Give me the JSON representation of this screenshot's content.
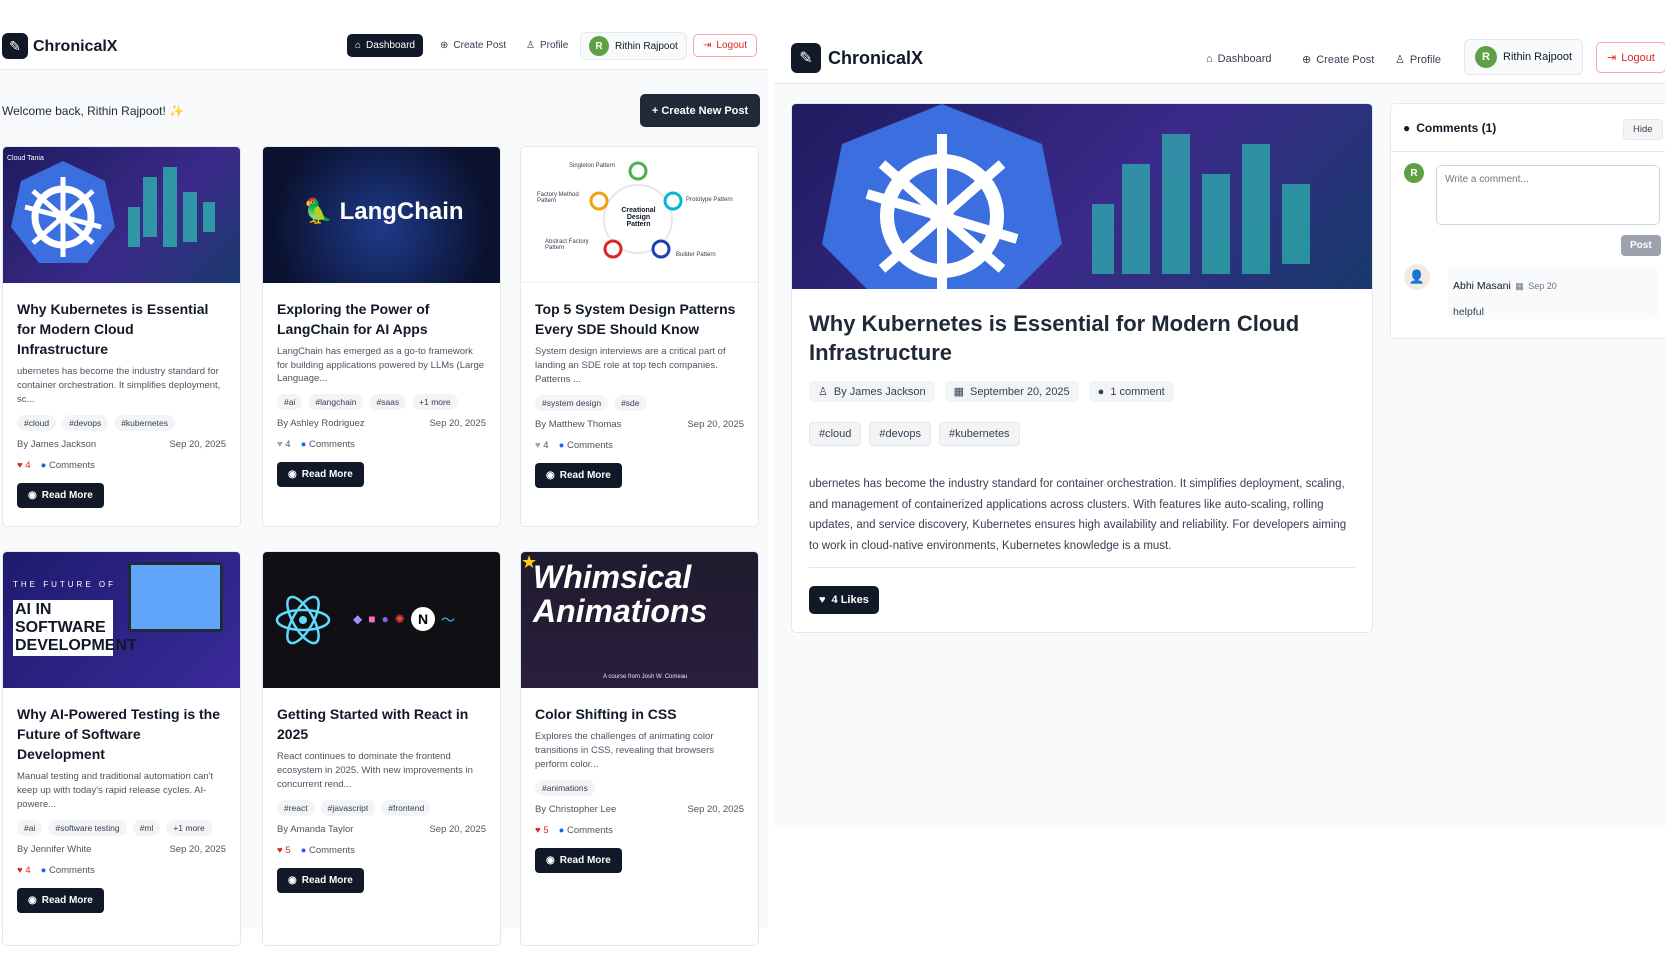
{
  "nav": {
    "brand": "ChronicalX",
    "dashboard": "Dashboard",
    "create_post": "Create Post",
    "profile": "Profile",
    "user_name": "Rithin Rajpoot",
    "user_initial": "R",
    "logout": "Logout"
  },
  "dashboard": {
    "welcome": "Welcome back, Rithin Rajpoot! ✨",
    "create_new_post": "Create New Post",
    "read_more": "Read More",
    "comments_label": "Comments",
    "posts": [
      {
        "title": "Why Kubernetes is Essential for Modern Cloud Infrastructure",
        "excerpt": "ubernetes has become the industry standard for container orchestration. It simplifies deployment, sc...",
        "tags": [
          "#cloud",
          "#devops",
          "#kubernetes"
        ],
        "author": "By James Jackson",
        "date": "Sep 20, 2025",
        "likes": "4",
        "liked": true,
        "image_text": "Cloud Tania"
      },
      {
        "title": "Exploring the Power of LangChain for AI Apps",
        "excerpt": "LangChain has emerged as a go-to framework for building applications powered by LLMs (Large Language...",
        "tags": [
          "#ai",
          "#langchain",
          "#saas",
          "+1 more"
        ],
        "author": "By Ashley Rodriguez",
        "date": "Sep 20, 2025",
        "likes": "4",
        "liked": false,
        "image_text": "LangChain"
      },
      {
        "title": "Top 5 System Design Patterns Every SDE Should Know",
        "excerpt": "System design interviews are a critical part of landing an SDE role at top tech companies. Patterns ...",
        "tags": [
          "#system design",
          "#sde"
        ],
        "author": "By Matthew Thomas",
        "date": "Sep 20, 2025",
        "likes": "4",
        "liked": false,
        "image_text": "Creational Design Pattern",
        "diagram": [
          "Singleton Pattern",
          "Factory Method Pattern",
          "Prototype Pattern",
          "Abstract Factory Pattern",
          "Builder Pattern"
        ]
      },
      {
        "title": "Why AI-Powered Testing is the Future of Software Development",
        "excerpt": "Manual testing and traditional automation can't keep up with today's rapid release cycles. AI-powere...",
        "tags": [
          "#ai",
          "#software testing",
          "#ml",
          "+1 more"
        ],
        "author": "By Jennifer White",
        "date": "Sep 20, 2025",
        "likes": "4",
        "liked": true,
        "image_text": "THE FUTURE OF",
        "image_text2": "AI IN SOFTWARE DEVELOPMENT"
      },
      {
        "title": "Getting Started with React in 2025",
        "excerpt": "React continues to dominate the frontend ecosystem in 2025. With new improvements in concurrent rend...",
        "tags": [
          "#react",
          "#javascript",
          "#frontend"
        ],
        "author": "By Amanda Taylor",
        "date": "Sep 20, 2025",
        "likes": "5",
        "liked": true,
        "image_text": "N"
      },
      {
        "title": "Color Shifting in CSS",
        "excerpt": "Explores the challenges of animating color transitions in CSS, revealing that browsers perform color...",
        "tags": [
          "#animations"
        ],
        "author": "By Christopher Lee",
        "date": "Sep 20, 2025",
        "likes": "5",
        "liked": true,
        "image_text": "Whimsical Animations",
        "image_text2": "A course from Josh W. Comeau"
      }
    ]
  },
  "article": {
    "title": "Why Kubernetes is Essential for Modern Cloud Infrastructure",
    "author": "By James Jackson",
    "date": "September 20, 2025",
    "comment_count": "1 comment",
    "tags": [
      "#cloud",
      "#devops",
      "#kubernetes"
    ],
    "content": "ubernetes has become the industry standard for container orchestration. It simplifies deployment, scaling, and management of containerized applications across clusters. With features like auto-scaling, rolling updates, and service discovery, Kubernetes ensures high availability and reliability. For developers aiming to work in cloud-native environments, Kubernetes knowledge is a must.",
    "likes": "4 Likes"
  },
  "comments": {
    "title": "Comments (1)",
    "hide": "Hide",
    "placeholder": "Write a comment...",
    "post": "Post",
    "items": [
      {
        "name": "Abhi Masani",
        "date": "Sep 20",
        "text": "helpful"
      }
    ]
  },
  "colors": {
    "primary": "#111827",
    "like_red": "#dc2626",
    "comment_blue": "#2563eb",
    "avatar_green": "#5fa044",
    "logout_red": "#dc2626"
  }
}
